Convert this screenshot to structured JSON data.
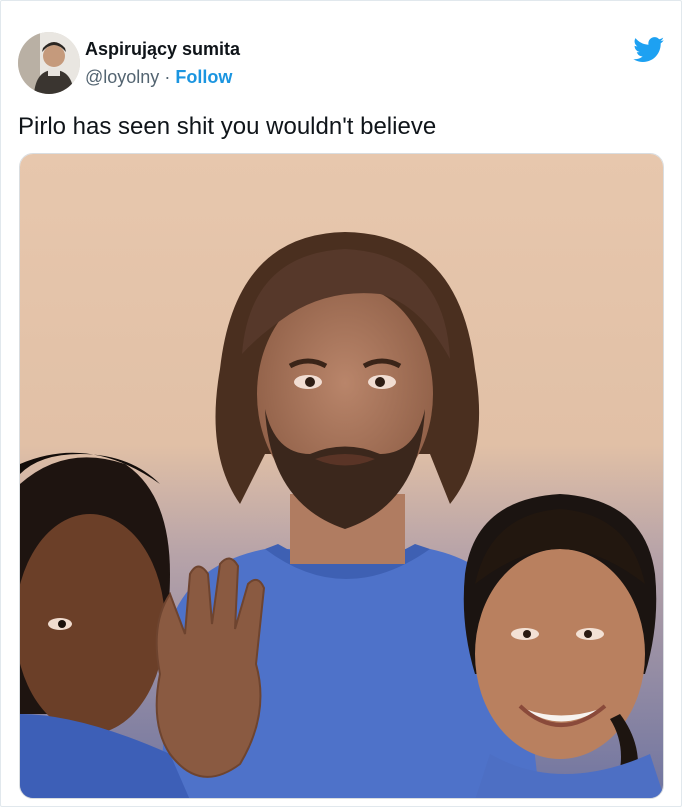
{
  "tweet": {
    "author": {
      "display_name": "Aspirujący sumita",
      "handle": "@loyolny",
      "separator": "·",
      "follow_label": "Follow"
    },
    "text": "Pirlo has seen shit you wouldn't believe",
    "platform_icon": "twitter-bird-icon",
    "brand_color": "#1da1f2",
    "link_color": "#1b95e0"
  },
  "media": {
    "kind": "photo"
  }
}
